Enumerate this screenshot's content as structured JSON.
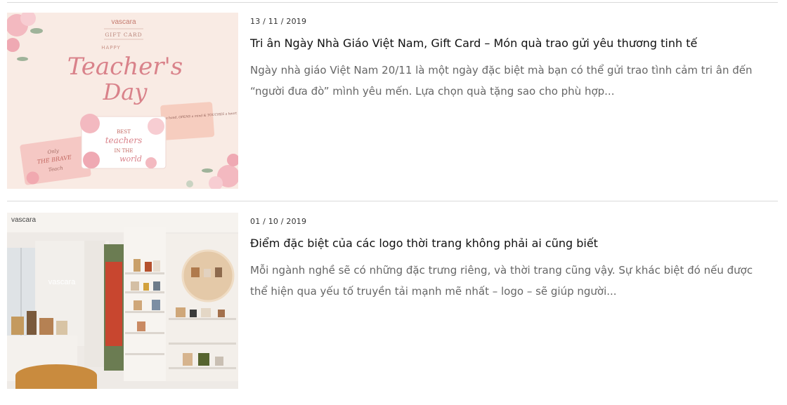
{
  "articles": [
    {
      "date": "13 / 11 / 2019",
      "title": "Tri ân Ngày Nhà Giáo Việt Nam, Gift Card – Món quà trao gửi yêu thương tinh tế",
      "excerpt": "Ngày nhà giáo Việt Nam 20/11 là một ngày đặc biệt mà bạn có thể gửi trao tình cảm tri ân đến “người đưa đò” mình yêu mến. Lựa chọn quà tặng sao cho phù hợp...",
      "image": {
        "brand": "vascara",
        "gift_card_label": "GIFT CARD",
        "happy": "HAPPY",
        "headline_1": "Teacher's",
        "headline_2": "Day",
        "card_left_1": "Only",
        "card_left_2": "THE BRAVE",
        "card_left_3": "Teach",
        "card_center_1": "BEST",
        "card_center_2": "teachers",
        "card_center_3": "IN THE",
        "card_center_4": "world",
        "card_right": "A teacher TAKES a hand, OPENS a mind & TOUCHES a heart"
      }
    },
    {
      "date": "01 / 10 / 2019",
      "title": "Điểm đặc biệt của các logo thời trang không phải ai cũng biết",
      "excerpt": "Mỗi ngành nghề sẽ có những đặc trưng riêng, và thời trang cũng vậy. Sự khác biệt đó nếu được thể hiện qua yếu tố truyền tải mạnh mẽ nhất – logo – sẽ giúp người...",
      "image": {
        "brand_corner": "vascara",
        "brand_wall": "vascara"
      }
    }
  ],
  "colors": {
    "divider": "#d9d9d9",
    "excerpt": "#666666",
    "title": "#111111",
    "peach_bg": "#f8e8e1",
    "rose": "#d9828a"
  }
}
